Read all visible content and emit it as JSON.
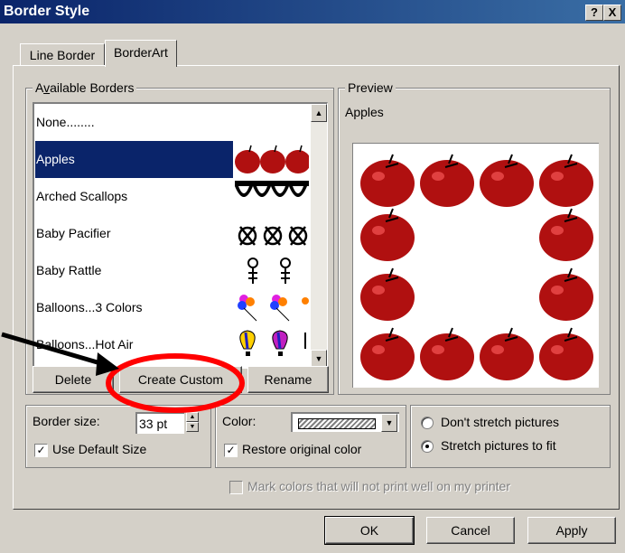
{
  "window": {
    "title": "Border Style",
    "help_label": "?",
    "close_label": "X"
  },
  "tabs": [
    {
      "label": "Line Border",
      "active": false
    },
    {
      "label": "BorderArt",
      "active": true
    }
  ],
  "available_borders": {
    "legend": "Available Borders",
    "items": [
      {
        "label": "None........",
        "selected": false,
        "thumb": "none"
      },
      {
        "label": "Apples",
        "selected": true,
        "thumb": "apples"
      },
      {
        "label": "Arched Scallops",
        "selected": false,
        "thumb": "scallops"
      },
      {
        "label": "Baby Pacifier",
        "selected": false,
        "thumb": "pacifier"
      },
      {
        "label": "Baby Rattle",
        "selected": false,
        "thumb": "rattle"
      },
      {
        "label": "Balloons...3 Colors",
        "selected": false,
        "thumb": "balloons"
      },
      {
        "label": "Balloons...Hot Air",
        "selected": false,
        "thumb": "hotair"
      }
    ],
    "buttons": {
      "delete": "Delete",
      "create_custom": "Create Custom",
      "rename": "Rename"
    }
  },
  "preview": {
    "legend": "Preview",
    "name": "Apples"
  },
  "options": {
    "border_size_label": "Border size:",
    "border_size_value": "33 pt",
    "use_default_size": "Use Default Size",
    "use_default_checked": true,
    "color_label": "Color:",
    "restore_original_color": "Restore original color",
    "restore_checked": true,
    "dont_stretch": "Don't stretch pictures",
    "stretch_to_fit": "Stretch pictures to fit",
    "stretch_selected": "fit",
    "mark_colors": "Mark colors that will not print well on my printer"
  },
  "footer": {
    "ok": "OK",
    "cancel": "Cancel",
    "apply": "Apply"
  },
  "colors": {
    "title_start": "#0a246a",
    "title_end": "#3a6ea5",
    "selection": "#0a246a",
    "apple_red": "#b01010",
    "annotation_red": "#ff0000"
  }
}
